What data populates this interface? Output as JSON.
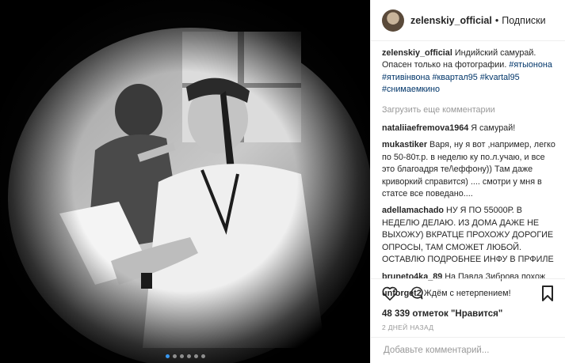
{
  "post": {
    "username": "zelenskiy_official",
    "separator": "•",
    "follow_label": "Подписки",
    "caption_text": "Индийский самурай. Опасен только на фотографии.",
    "caption_tags": "#ятыонона #ятивінвона #квартал95 #kvartal95 #снимаемкино",
    "load_more_label": "Загрузить еще комментарии",
    "likes_text": "48 339 отметок \"Нравится\"",
    "date_text": "2 дней назад",
    "add_comment_placeholder": "Добавьте комментарий...",
    "photo_slide_count": 6,
    "photo_active_slide": 1
  },
  "comments": [
    {
      "user": "nataliiaefremova1964",
      "text": "Я самурай!"
    },
    {
      "user": "mukastiker",
      "text": "Варя, ну я вот ,например, легко по 50-80т.р. в неделю ку по.л.учаю, и все это благоадря те/\\еффону)) Там даже криворкий справится) .... смотри у мня в статсе все поведано...."
    },
    {
      "user": "adellamachado",
      "text": "НУ Я ПО 55000Р. В НЕДЕЛЮ ДЕЛАЮ. ИЗ ДОМА ДАЖЕ НЕ ВЫХОЖУ) ВКРАТЦЕ ПРОХОЖУ ДОРОГИЕ ОПРОСЫ, ТАМ СМОЖЕТ ЛЮБОЙ. ОСТАВЛЮ ПОДРОБНЕЕ ИНФУ В ПРФИЛЕ"
    },
    {
      "user": "bruneto4ka_89",
      "text": "На Павла Зиброва похож"
    },
    {
      "user": "unforget2",
      "text": "Ждём с нетерпением!"
    }
  ],
  "icons": [
    "heart-icon",
    "comment-icon",
    "bookmark-icon"
  ],
  "colors": {
    "link": "#003569",
    "muted": "#999999",
    "dot_active": "#3897f0"
  }
}
